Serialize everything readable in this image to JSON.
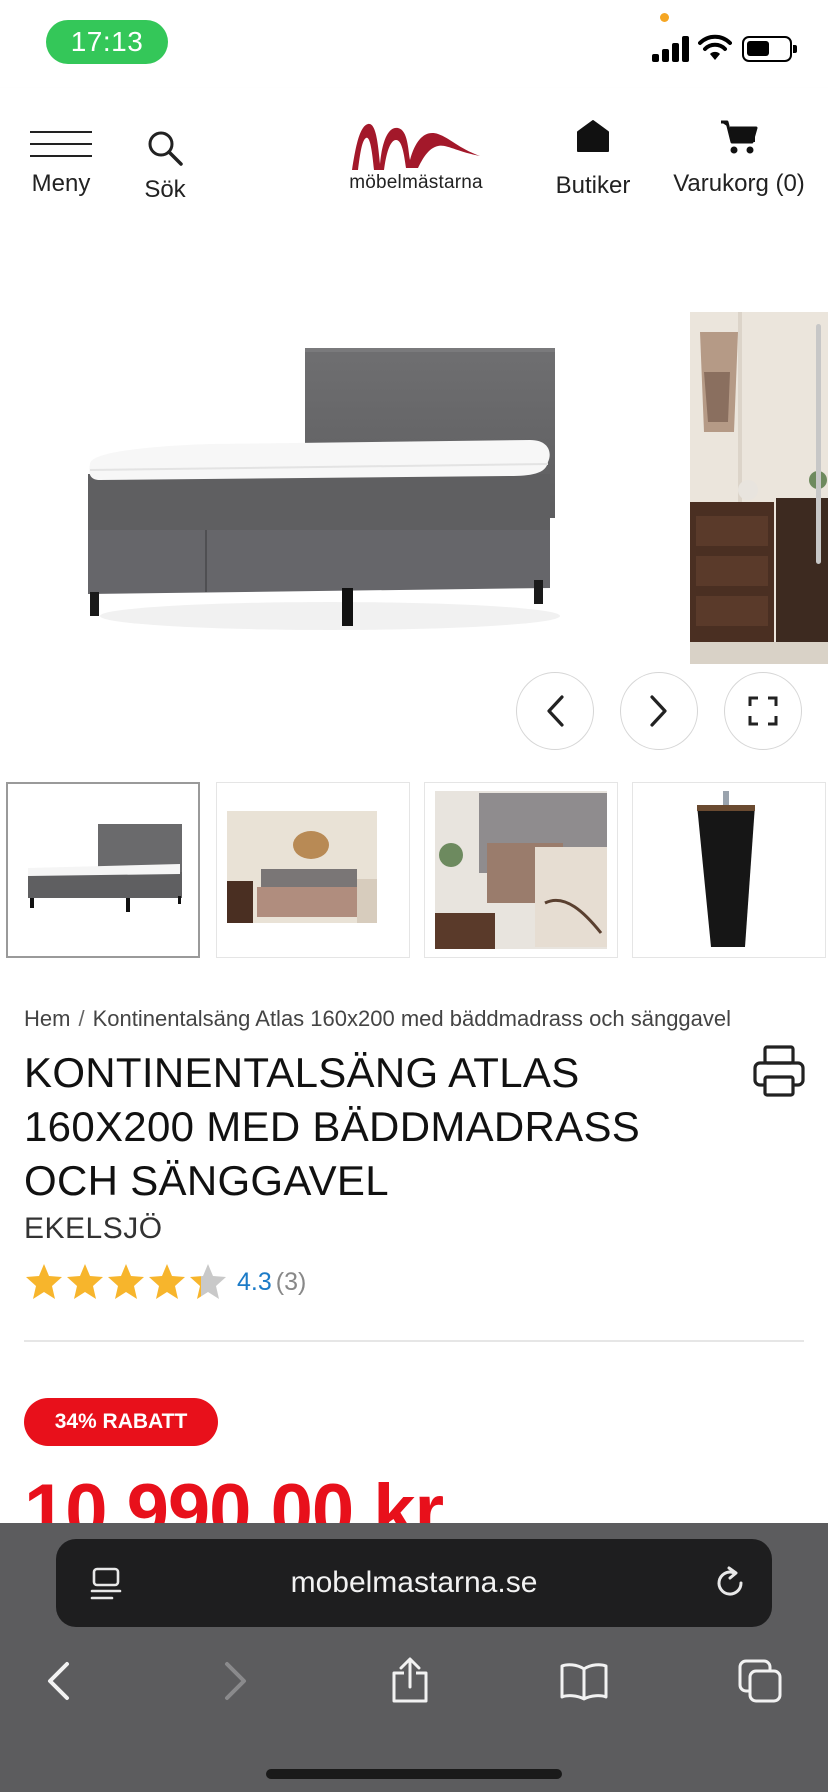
{
  "status_bar": {
    "time": "17:13"
  },
  "header": {
    "menu_label": "Meny",
    "search_label": "Sök",
    "logo_text": "möbelmästarna",
    "stores_label": "Butiker",
    "cart_label": "Varukorg (0)",
    "brand_color": "#a3182a"
  },
  "gallery": {
    "thumbnail_count": 4,
    "active_thumbnail": 1
  },
  "product": {
    "breadcrumb": [
      "Hem",
      "/",
      "Kontinentalsäng Atlas 160x200 med bäddmadrass och sänggavel"
    ],
    "title": "KONTINENTALSÄNG ATLAS 160X200 MED BÄDDMADRASS OCH SÄNGGAVEL",
    "brand": "EKELSJÖ",
    "rating_value": 4.3,
    "rating_display": "4.3",
    "review_count_display": "(3)",
    "discount_badge": "34% RABATT",
    "price": "10 990,00 kr",
    "price_color": "#e8101b"
  },
  "browser": {
    "url": "mobelmastarna.se"
  }
}
